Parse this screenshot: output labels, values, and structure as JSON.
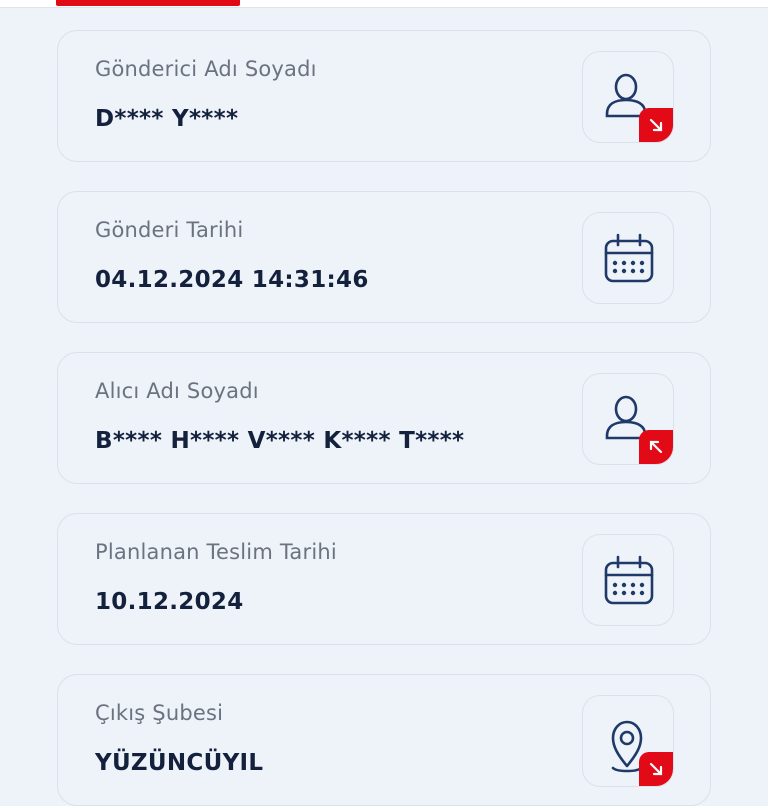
{
  "cards": [
    {
      "label": "Gönderici Adı Soyadı",
      "value": "D**** Y****",
      "icon": "person-outgoing-icon"
    },
    {
      "label": "Gönderi Tarihi",
      "value": "04.12.2024 14:31:46",
      "icon": "calendar-icon"
    },
    {
      "label": "Alıcı Adı Soyadı",
      "value": "B**** H**** V**** K**** T****",
      "icon": "person-incoming-icon"
    },
    {
      "label": "Planlanan Teslim Tarihi",
      "value": "10.12.2024",
      "icon": "calendar-icon"
    },
    {
      "label": "Çıkış Şubesi",
      "value": "YÜZÜNCÜYIL",
      "icon": "location-pin-icon"
    }
  ],
  "colors": {
    "accent": "#e30a17",
    "icon": "#1f3a68",
    "text": "#14213d",
    "label": "#6b7280"
  }
}
